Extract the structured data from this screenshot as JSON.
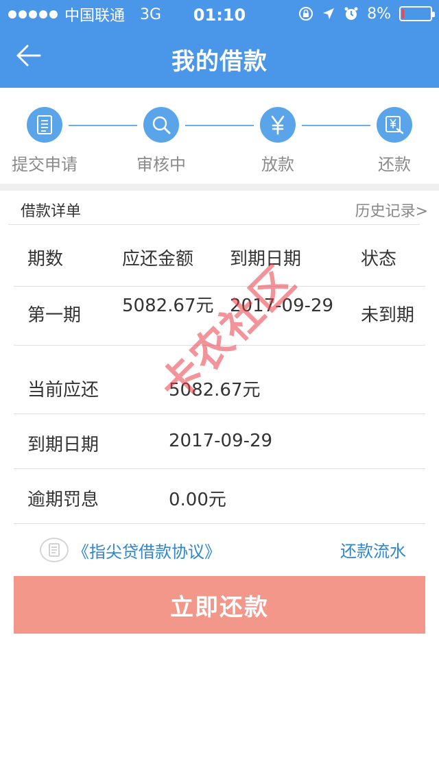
{
  "status_bar": {
    "carrier": "中国联通",
    "network": "3G",
    "time": "01:10",
    "battery_percent": "8%",
    "battery_level": 0.08
  },
  "nav": {
    "title": "我的借款",
    "back_icon": "back-arrow-icon"
  },
  "steps": [
    {
      "label": "提交申请",
      "icon": "document-icon"
    },
    {
      "label": "审核中",
      "icon": "search-icon"
    },
    {
      "label": "放款",
      "icon": "yuan-icon"
    },
    {
      "label": "还款",
      "icon": "bill-icon"
    }
  ],
  "detail": {
    "title": "借款详单",
    "history_link": "历史记录>"
  },
  "table": {
    "headers": [
      "期数",
      "应还金额",
      "到期日期",
      "状态"
    ],
    "rows": [
      {
        "period": "第一期",
        "amount": "5082.67元",
        "due": "2017-09-29",
        "status": "未到期"
      }
    ]
  },
  "summary": [
    {
      "key": "当前应还",
      "value": "5082.67元"
    },
    {
      "key": "到期日期",
      "value": "2017-09-29"
    },
    {
      "key": "逾期罚息",
      "value": "0.00元"
    }
  ],
  "agreement": {
    "text": "《指尖贷借款协议》",
    "flow_link": "还款流水"
  },
  "repay_button": "立即还款",
  "watermark": "卡农社区",
  "colors": {
    "header_blue": "#4a96e8",
    "step_blue": "#5aa5ea",
    "link_blue": "#2e86cf",
    "button_salmon": "#f3978a",
    "watermark_red": "#e83c46"
  }
}
